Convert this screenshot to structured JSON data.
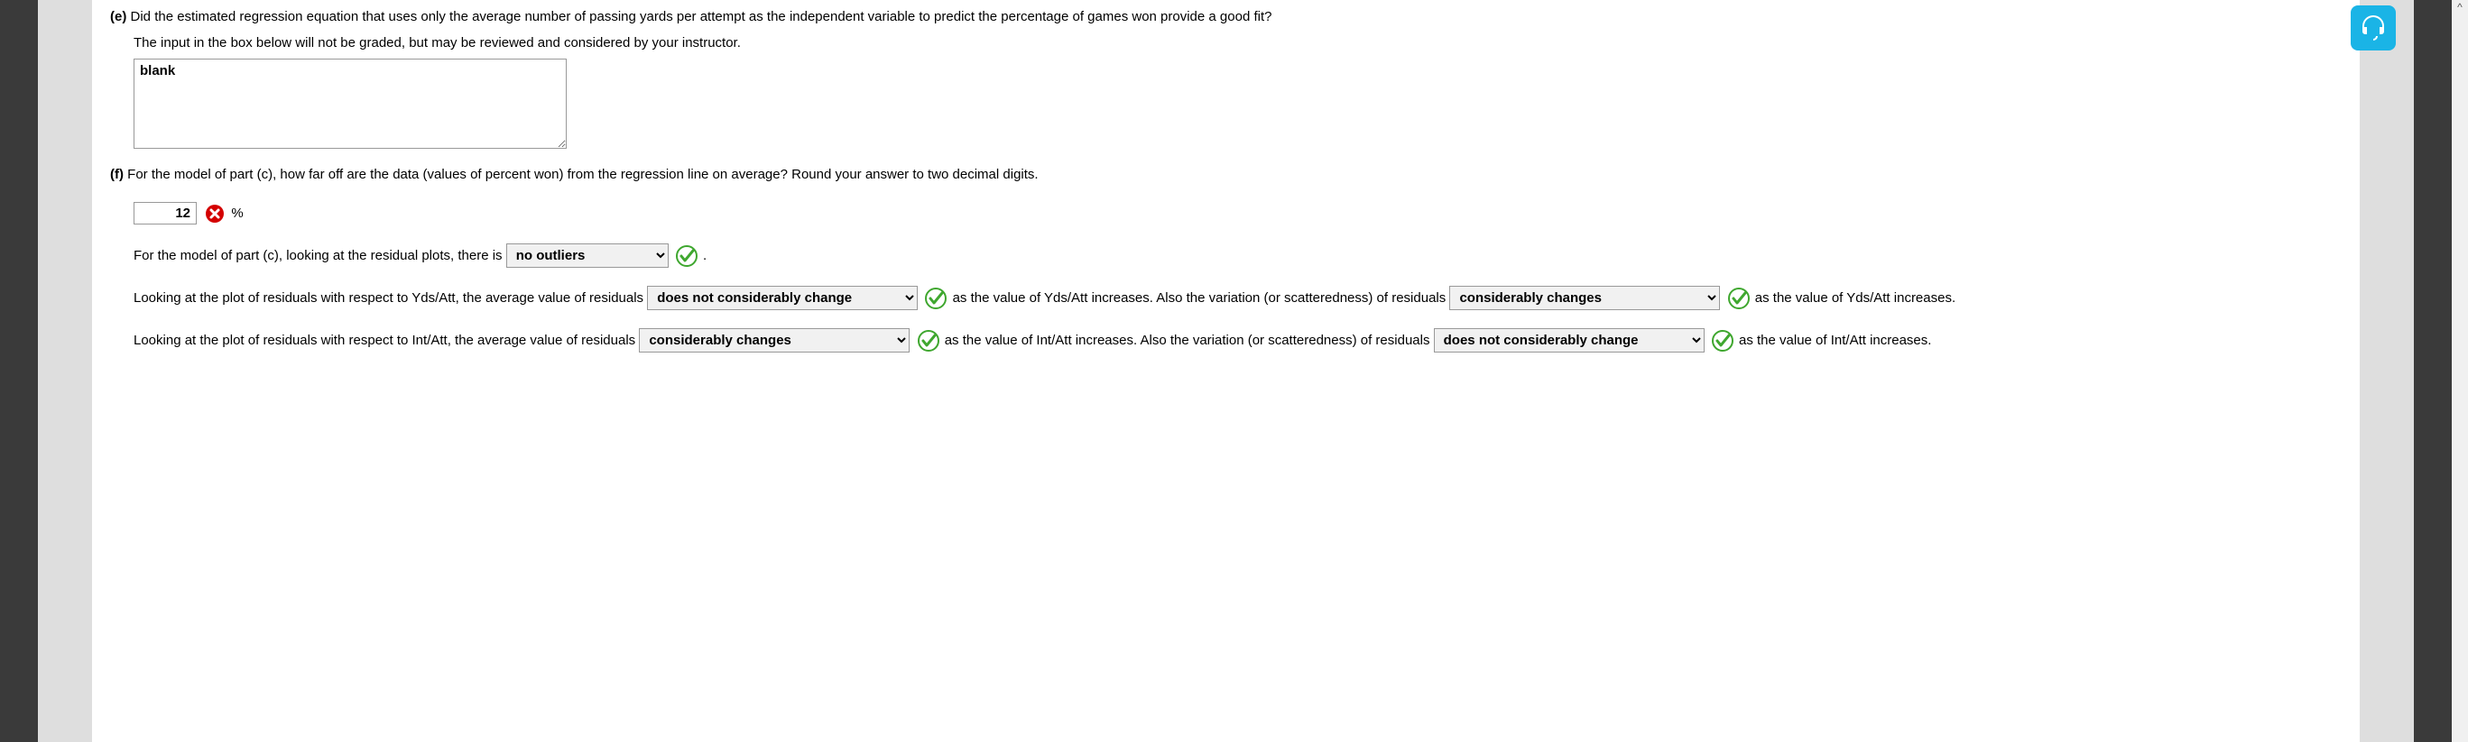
{
  "parts": {
    "e": {
      "label": "(e)",
      "question": "Did the estimated regression equation that uses only the average number of passing yards per attempt as the independent variable to predict the percentage of games won provide a good fit?",
      "note": "The input in the box below will not be graded, but may be reviewed and considered by your instructor.",
      "textarea_value": "blank"
    },
    "f": {
      "label": "(f)",
      "question": "For the model of part (c), how far off are the data (values of percent won) from the regression line on average? Round your answer to two decimal digits.",
      "answer_value": "12",
      "answer_unit": "%",
      "line1_prefix": "For the model of part (c), looking at the residual plots, there is",
      "dropdown_outliers": "no outliers",
      "line1_suffix": ".",
      "line2_prefix": "Looking at the plot of residuals with respect to Yds/Att, the average value of residuals",
      "dropdown_ydsatt_avg": "does not considerably change",
      "line2_mid": "as the value of Yds/Att increases. Also the variation (or scatteredness) of residuals",
      "dropdown_ydsatt_var": "considerably changes",
      "line2_suffix": "as the value of Yds/Att increases.",
      "line3_prefix": "Looking at the plot of residuals with respect to Int/Att, the average value of residuals",
      "dropdown_intatt_avg": "considerably changes",
      "line3_mid": "as the value of Int/Att increases. Also the variation (or scatteredness) of residuals",
      "dropdown_intatt_var": "does not considerably change",
      "line3_suffix": "as the value of Int/Att increases."
    }
  },
  "icons": {
    "correct": "correct-check",
    "incorrect": "incorrect-x"
  }
}
